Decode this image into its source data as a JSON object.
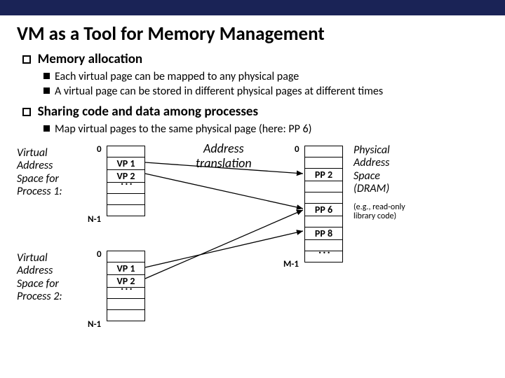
{
  "title": "VM as a Tool for Memory Management",
  "bullets": {
    "b1": "Memory allocation",
    "b1_1": "Each virtual page can be mapped to any physical page",
    "b1_2": "A virtual page can be stored in different physical pages at different times",
    "b2": "Sharing code and data among processes",
    "b2_1": "Map virtual pages to the same physical page (here: PP 6)"
  },
  "labels": {
    "vas1": "Virtual\nAddress\nSpace for\nProcess 1:",
    "vas2": "Virtual\nAddress\nSpace for\nProcess 2:",
    "pas": "Physical\nAddress\nSpace\n(DRAM)",
    "trans": "Address\ntranslation",
    "note": "(e.g., read-only\nlibrary code)"
  },
  "tables": {
    "p1": [
      "",
      "VP 1",
      "VP 2",
      "",
      "",
      ""
    ],
    "p2": [
      "",
      "VP 1",
      "VP 2",
      "",
      "",
      ""
    ],
    "phys": [
      "",
      "",
      "PP 2",
      "",
      "",
      "PP 6",
      "",
      "PP 8",
      "",
      ""
    ]
  },
  "idx": {
    "zero": "0",
    "n1": "N-1",
    "m1": "M-1"
  },
  "dots": "..."
}
